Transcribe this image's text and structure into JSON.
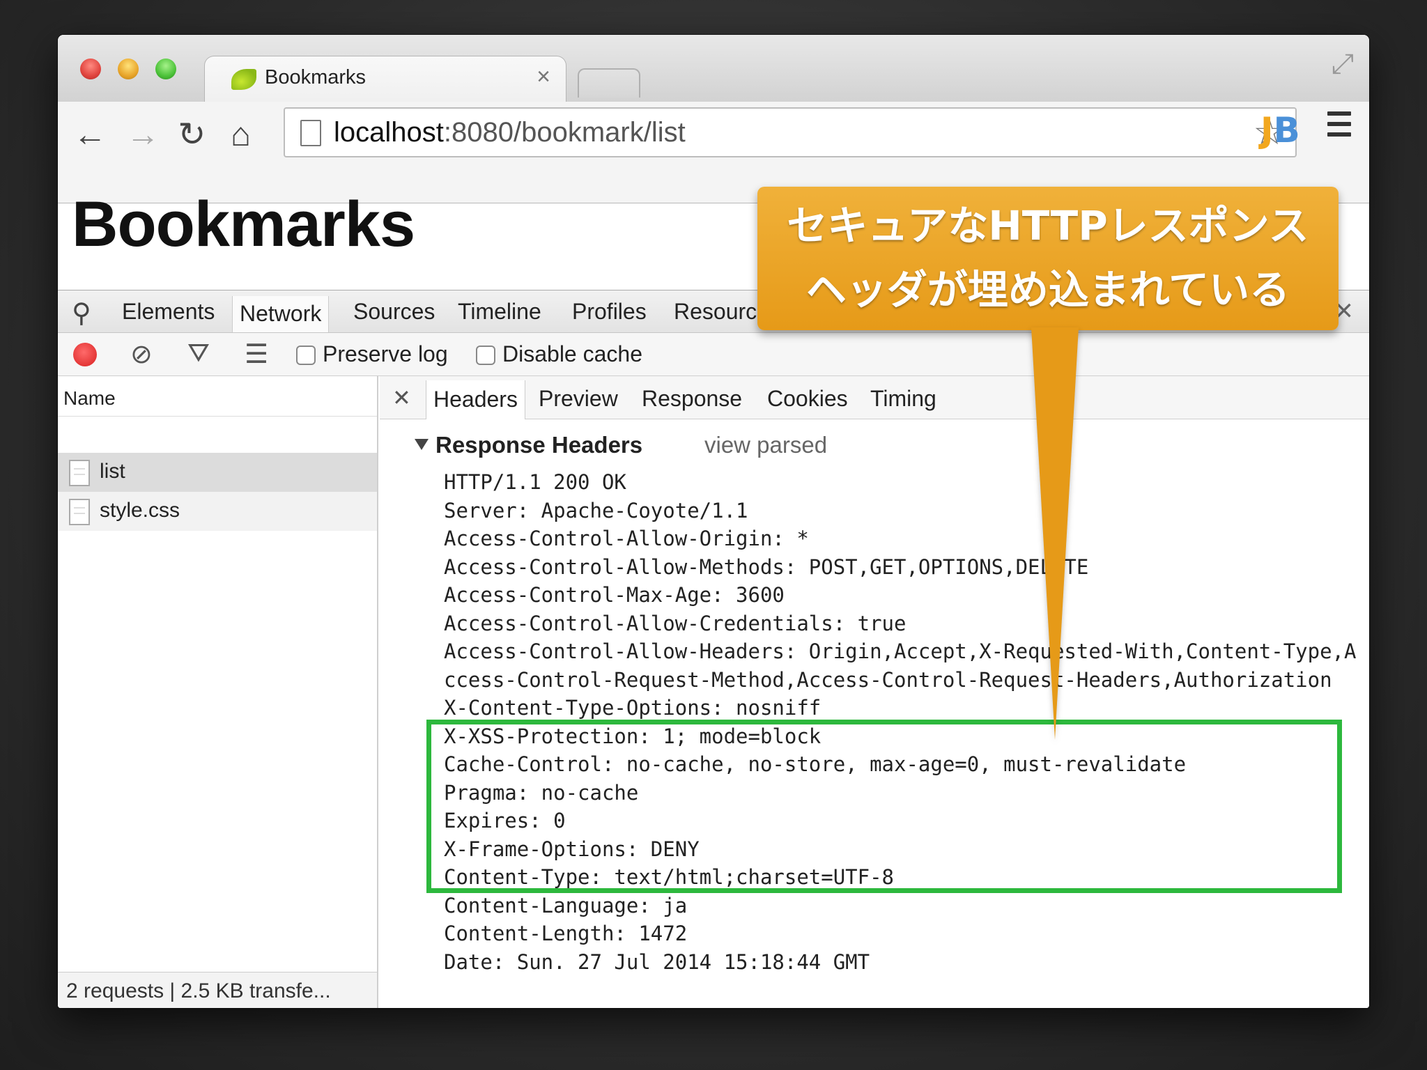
{
  "browser": {
    "tab_title": "Bookmarks",
    "tab_close": "×",
    "url_host": "localhost",
    "url_path": ":8080/bookmark/list",
    "jb_j": "J",
    "jb_b": "B"
  },
  "page": {
    "title": "Bookmarks"
  },
  "devtools": {
    "tabs": [
      "Elements",
      "Network",
      "Sources",
      "Timeline",
      "Profiles",
      "Resourc"
    ],
    "active_tab": "Network",
    "preserve_log_label": "Preserve log",
    "disable_cache_label": "Disable cache",
    "name_column": "Name",
    "files": [
      "list",
      "style.css"
    ],
    "status": "2 requests | 2.5 KB transfe...",
    "detail_tabs": [
      "Headers",
      "Preview",
      "Response",
      "Cookies",
      "Timing"
    ],
    "active_detail_tab": "Headers",
    "section_title": "Response Headers",
    "view_parsed": "view parsed",
    "response_headers": [
      "HTTP/1.1 200 OK",
      "Server: Apache-Coyote/1.1",
      "Access-Control-Allow-Origin: *",
      "Access-Control-Allow-Methods: POST,GET,OPTIONS,DELETE",
      "Access-Control-Max-Age: 3600",
      "Access-Control-Allow-Credentials: true",
      "Access-Control-Allow-Headers: Origin,Accept,X-Requested-With,Content-Type,Access-Control-Request-Method,Access-Control-Request-Headers,Authorization",
      "X-Content-Type-Options: nosniff",
      "X-XSS-Protection: 1; mode=block",
      "Cache-Control: no-cache, no-store, max-age=0, must-revalidate",
      "Pragma: no-cache",
      "Expires: 0",
      "X-Frame-Options: DENY",
      "Content-Type: text/html;charset=UTF-8",
      "Content-Language: ja",
      "Content-Length: 1472",
      "Date: Sun. 27 Jul 2014 15:18:44 GMT"
    ]
  },
  "callout": {
    "line1": "セキュアなHTTPレスポンス",
    "line2": "ヘッダが埋め込まれている"
  },
  "colors": {
    "highlight": "#2db83d",
    "callout": "#e69a18"
  }
}
